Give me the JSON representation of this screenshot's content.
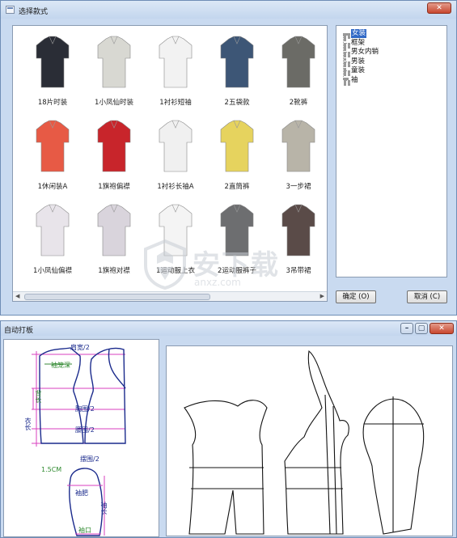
{
  "style_window": {
    "title": "选择款式",
    "garments": [
      {
        "label": "18片时装",
        "icon": "suit-jacket-icon",
        "color": "#2a2d36"
      },
      {
        "label": "1小凤仙时装",
        "icon": "floral-blouse-icon",
        "color": "#d8d8d2"
      },
      {
        "label": "1衬衫短袖",
        "icon": "white-shirt-icon",
        "color": "#f2f2f2"
      },
      {
        "label": "2五袋款",
        "icon": "jeans-icon",
        "color": "#3d5676"
      },
      {
        "label": "2靴裤",
        "icon": "plaid-pants-icon",
        "color": "#6b6b66"
      },
      {
        "label": "1休闲装A",
        "icon": "red-sweater-icon",
        "color": "#e75a45"
      },
      {
        "label": "1旗袍偏襟",
        "icon": "red-qipao-icon",
        "color": "#c8252b"
      },
      {
        "label": "1衬衫长袖A",
        "icon": "long-sleeve-shirt-icon",
        "color": "#f0f0f0"
      },
      {
        "label": "2直筒裤",
        "icon": "yellow-pants-icon",
        "color": "#e6d35e"
      },
      {
        "label": "3一步裙",
        "icon": "pencil-skirt-icon",
        "color": "#b8b4a8"
      },
      {
        "label": "1小凤仙偏襟",
        "icon": "white-qipao-icon",
        "color": "#e8e4ea"
      },
      {
        "label": "1旗袍对襟",
        "icon": "qipao-set-icon",
        "color": "#d9d4dc"
      },
      {
        "label": "1运动服上衣",
        "icon": "track-jacket-icon",
        "color": "#f4f4f4"
      },
      {
        "label": "2运动服裤子",
        "icon": "track-pants-icon",
        "color": "#6d6e70"
      },
      {
        "label": "3吊带裙",
        "icon": "camisole-icon",
        "color": "#5a4b48"
      }
    ],
    "tree": [
      {
        "label": "女装",
        "selected": true
      },
      {
        "label": "框架",
        "selected": false
      },
      {
        "label": "男女内销",
        "selected": false
      },
      {
        "label": "男装",
        "selected": false
      },
      {
        "label": "童装",
        "selected": false
      },
      {
        "label": "袖",
        "selected": false
      }
    ],
    "ok_label": "确定 (O)",
    "cancel_label": "取消 (C)"
  },
  "pattern_window": {
    "title": "自动打板",
    "measure_labels": {
      "shoulder_width": "肩宽/2",
      "armhole": "袖笼深",
      "back_length": "背长",
      "chest": "胸围/2",
      "waist": "腰围/2",
      "body_length": "衣长",
      "hip": "摆围/2",
      "ease": "1.5CM",
      "bicep": "袖肥",
      "sleeve_length": "袖长",
      "cuff": "袖口"
    }
  },
  "watermark": {
    "brand": "安下载",
    "site": "anxz.com"
  }
}
